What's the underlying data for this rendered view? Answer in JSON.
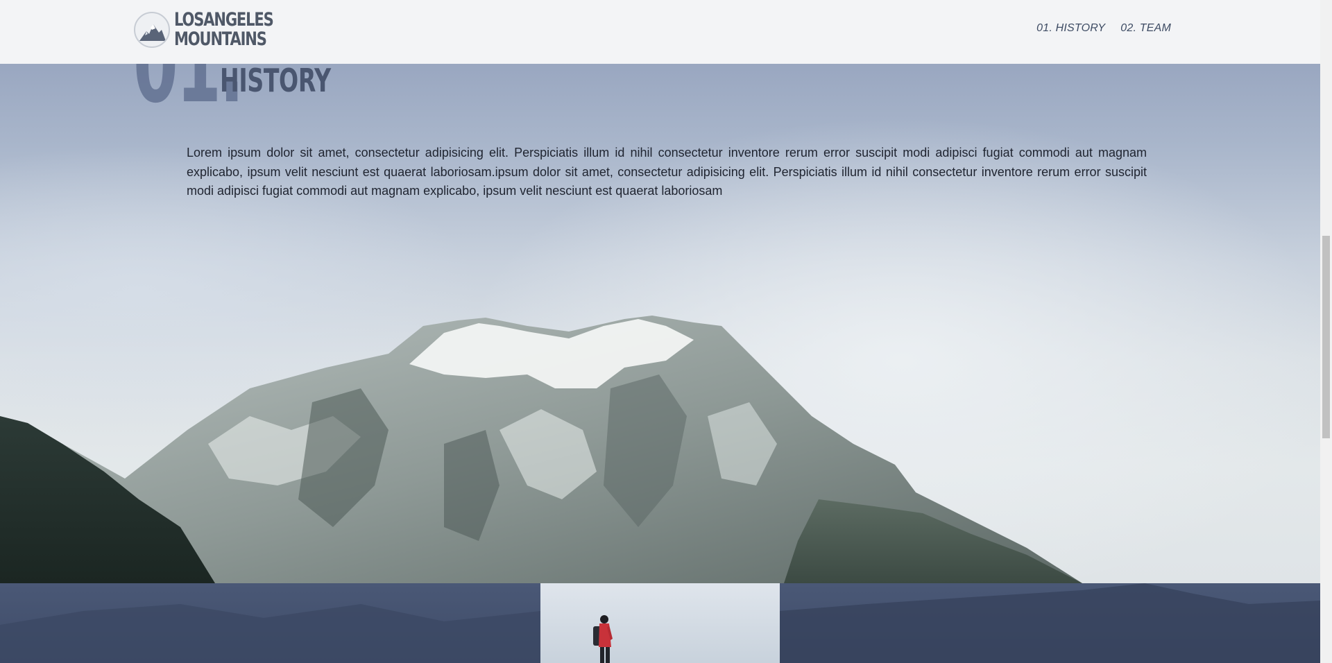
{
  "brand": {
    "line1": "LOSANGELES",
    "line2": "MOUNTAINS"
  },
  "nav": {
    "items": [
      {
        "label": "01. HISTORY"
      },
      {
        "label": "02. TEAM"
      }
    ]
  },
  "history": {
    "number": "01.",
    "title": "HISTORY",
    "text": "Lorem ipsum dolor sit amet, consectetur adipisicing elit. Perspiciatis illum id nihil consectetur inventore rerum error suscipit modi adipisci fugiat commodi aut magnam explicabo, ipsum velit nesciunt est quaerat laboriosam.ipsum dolor sit amet, consectetur adipisicing elit. Perspiciatis illum id nihil consectetur inventore rerum error suscipit modi adipisci fugiat commodi aut magnam explicabo, ipsum velit nesciunt est quaerat laboriosam"
  },
  "colors": {
    "header_bg": "#f3f4f6",
    "nav_text": "#3d4b63",
    "heading": "#4a5670",
    "strip_overlay": "#45526f"
  }
}
